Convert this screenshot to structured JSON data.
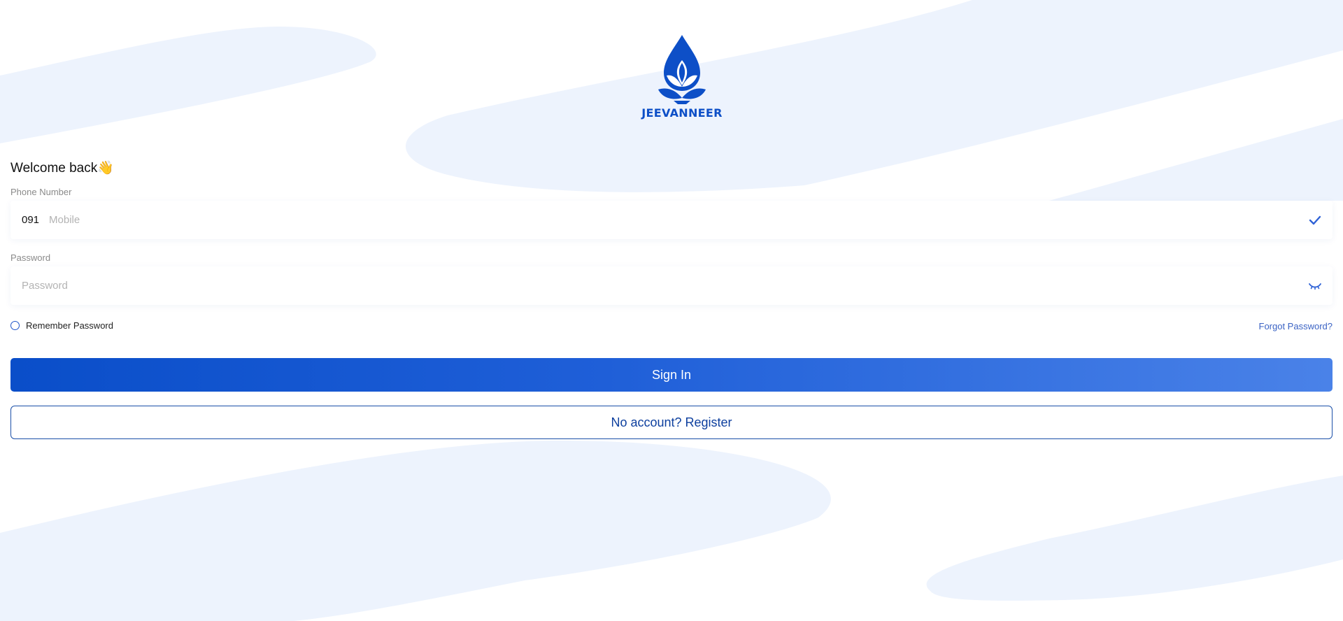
{
  "brand": {
    "name": "JEEVANNEER",
    "color": "#0d4fc7"
  },
  "login": {
    "welcome": "Welcome back👋",
    "phone": {
      "label": "Phone Number",
      "prefix": "091",
      "placeholder": "Mobile",
      "status_icon": "check-icon"
    },
    "password": {
      "label": "Password",
      "placeholder": "Password",
      "toggle_icon": "eye-closed-icon"
    },
    "remember_label": "Remember Password",
    "forgot_label": "Forgot Password?",
    "signin_label": "Sign In",
    "register_label": "No account? Register"
  },
  "colors": {
    "primary": "#1f5fd8",
    "link": "#3b63c4",
    "background_shape": "#edf3fd"
  }
}
